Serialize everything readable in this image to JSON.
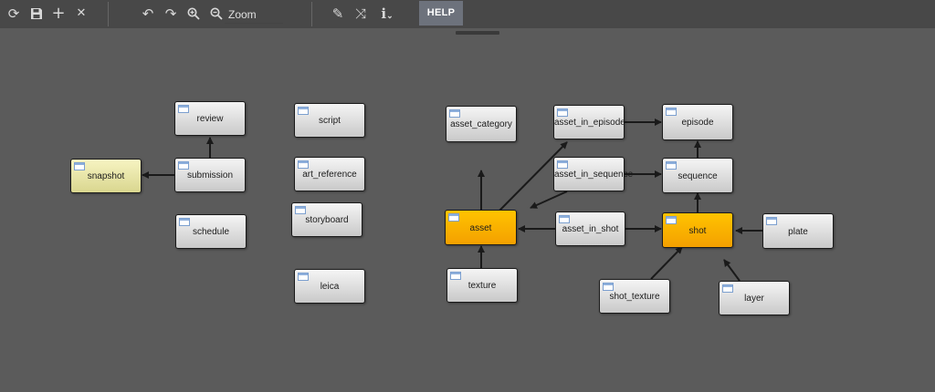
{
  "toolbar": {
    "zoom_placeholder": "Zoom",
    "help_label": "HELP"
  },
  "nodes": {
    "review": "review",
    "submission": "submission",
    "snapshot": "snapshot",
    "schedule": "schedule",
    "script": "script",
    "art_reference": "art_reference",
    "storyboard": "storyboard",
    "leica": "leica",
    "asset_category": "asset_category",
    "asset": "asset",
    "texture": "texture",
    "asset_in_episode": "asset_in_episode",
    "asset_in_sequence": "asset_in_sequence",
    "asset_in_shot": "asset_in_shot",
    "episode": "episode",
    "sequence": "sequence",
    "shot": "shot",
    "plate": "plate",
    "shot_texture": "shot_texture",
    "layer": "layer"
  },
  "colors": {
    "background": "#5b5b5b",
    "toolbar": "#484848",
    "node_default": "#dcdcdc",
    "node_highlight": "#f7a800",
    "node_selected": "#ebe8a8",
    "edge": "#1a1a1a"
  }
}
